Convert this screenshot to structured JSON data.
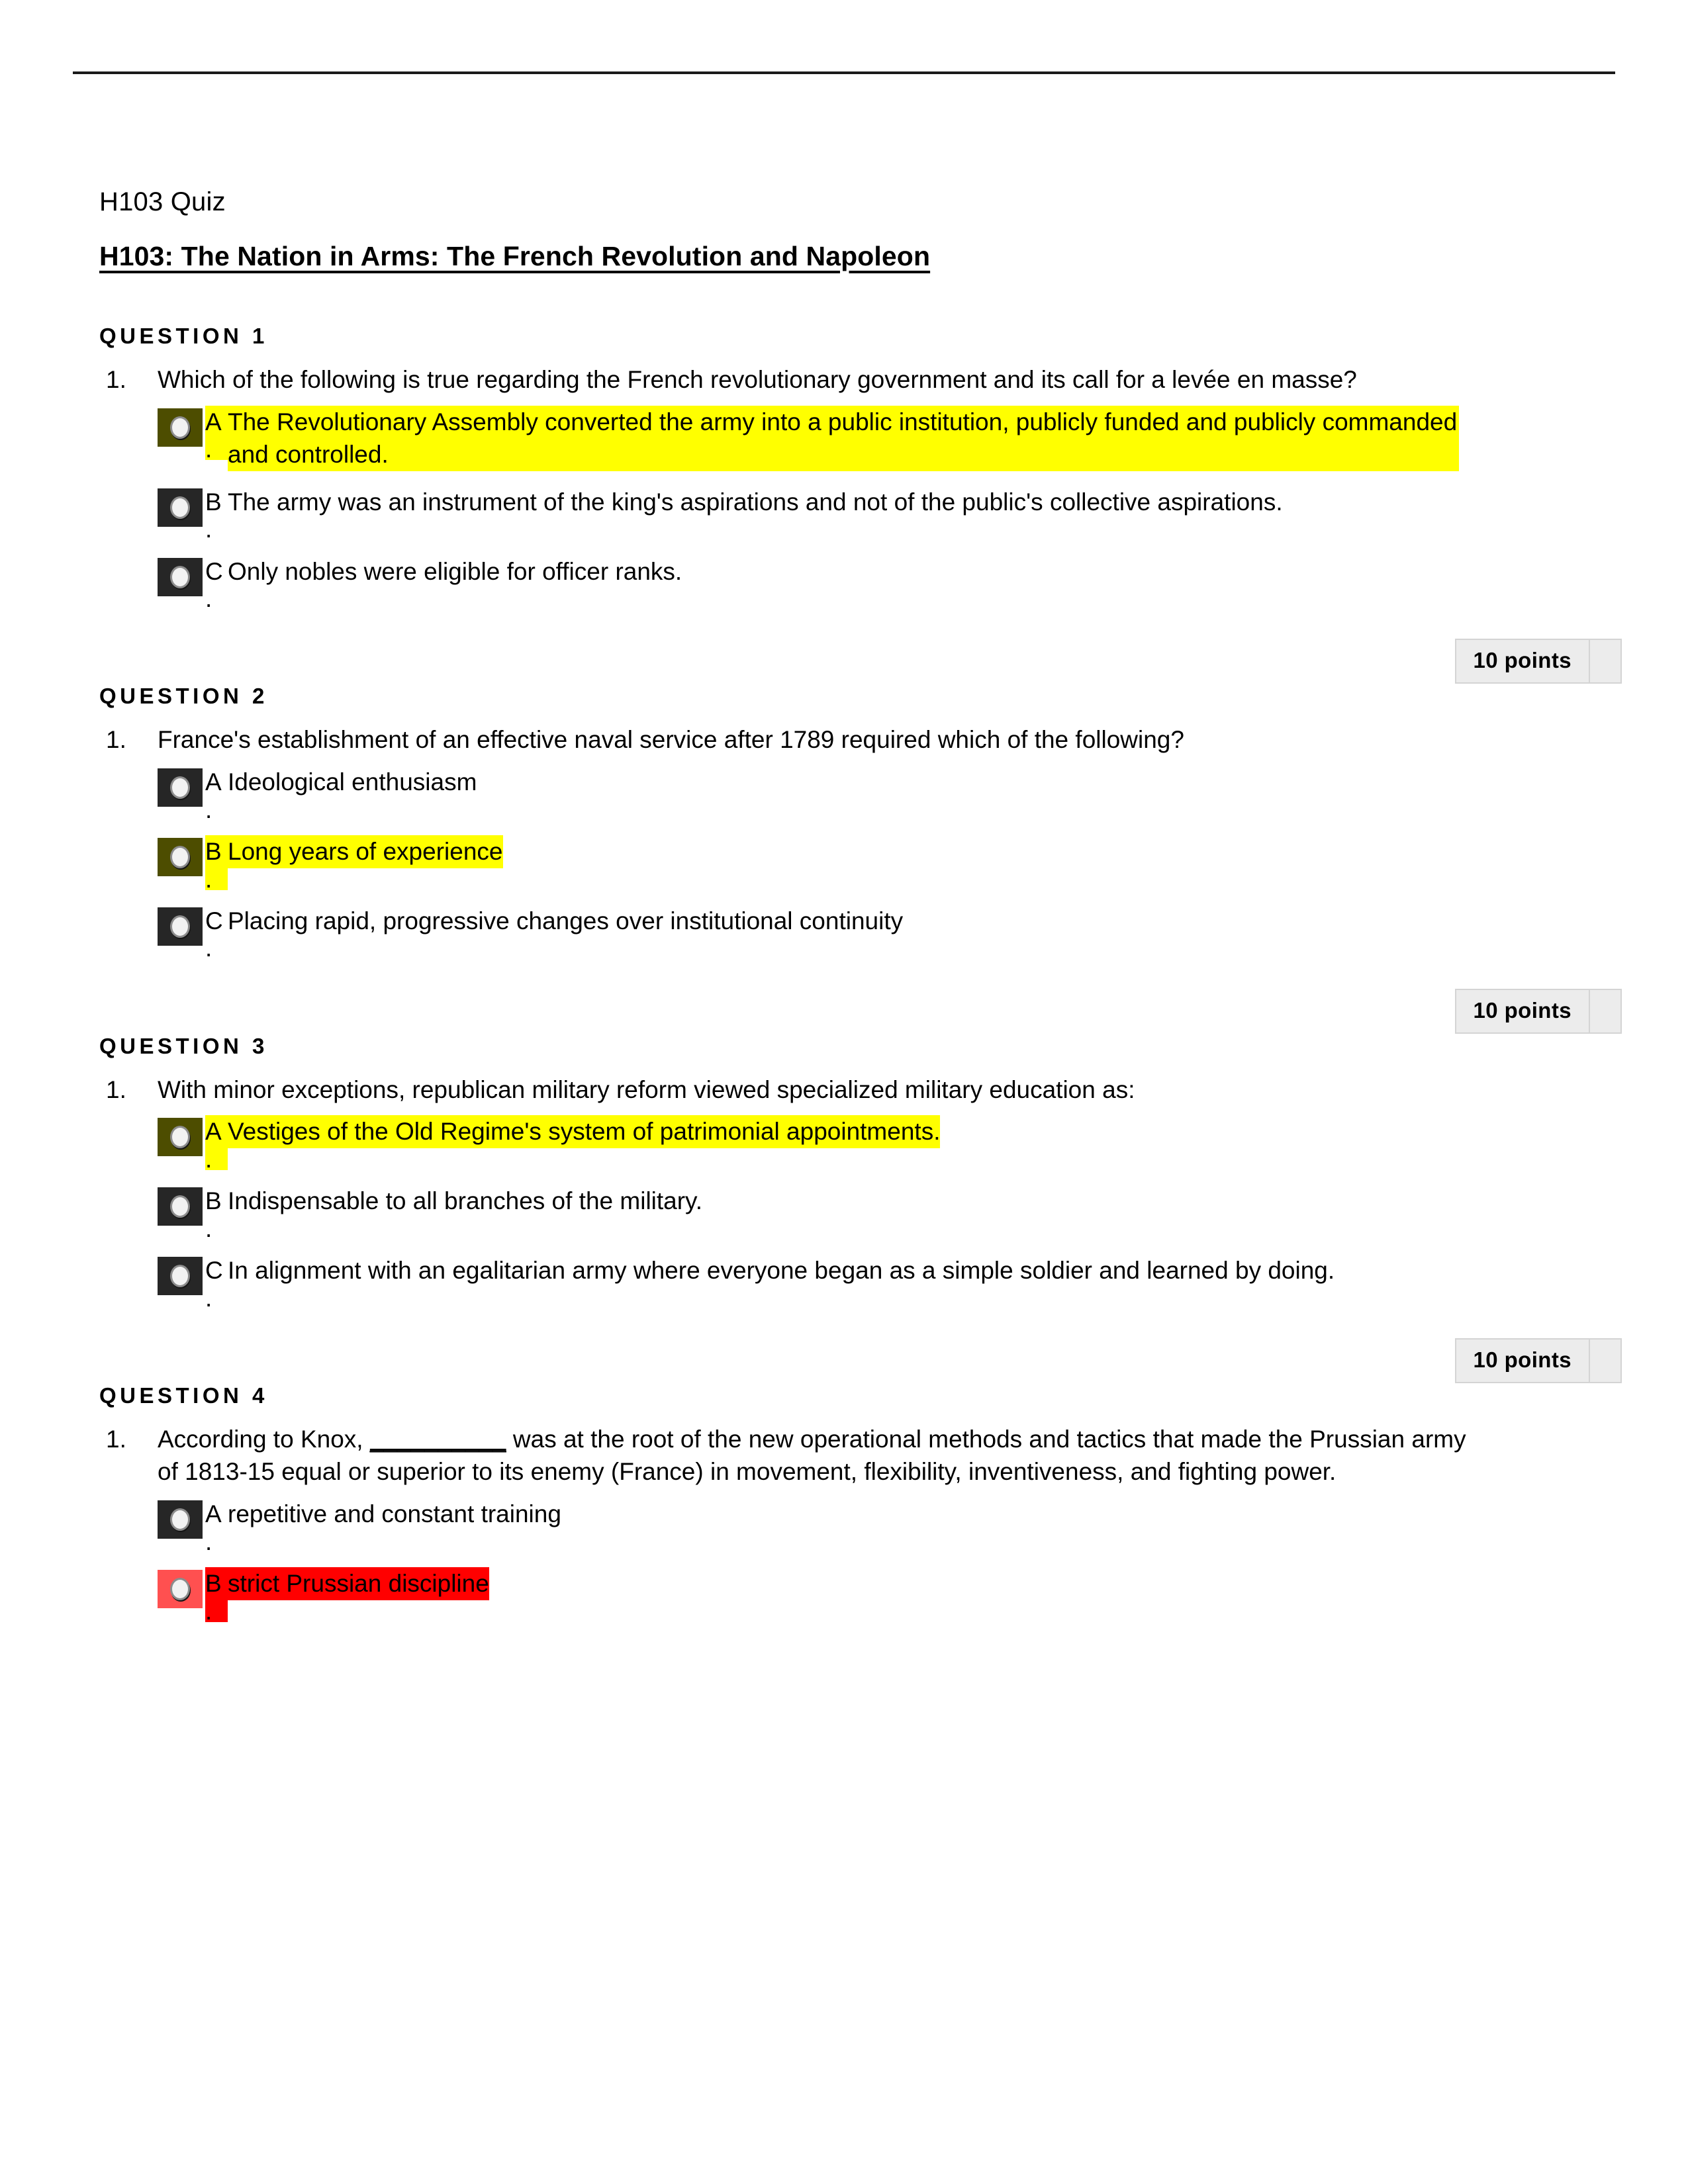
{
  "document": {
    "title": "H103 Quiz",
    "heading": "H103: The Nation in Arms: The French Revolution and Napoleon"
  },
  "colors": {
    "highlight_correct": "#ffff00",
    "highlight_incorrect": "#ff0000",
    "radio_unselected_bg": "#262626",
    "radio_selected_yellow_bg": "#4d4d00",
    "radio_selected_red_bg": "#ff5050",
    "points_bg": "#ececec"
  },
  "questions": [
    {
      "label": "QUESTION 1",
      "number": "1.",
      "prompt": "Which of the following is true regarding the French revolutionary government and its call for a levée en masse?",
      "points": "10 points",
      "options": [
        {
          "letter": "A",
          "dot": ".",
          "text": "The Revolutionary Assembly converted the army into a public institution, publicly funded and publicly commanded and controlled.",
          "highlight": "yellow",
          "selected": true
        },
        {
          "letter": "B",
          "dot": ".",
          "text": "The army was an instrument of the king's aspirations and not of the public's collective aspirations.",
          "highlight": "none",
          "selected": false
        },
        {
          "letter": "C",
          "dot": ".",
          "text": "Only nobles were eligible for officer ranks.",
          "highlight": "none",
          "selected": false
        }
      ]
    },
    {
      "label": "QUESTION 2",
      "number": "1.",
      "prompt": "France's establishment of an effective naval service after 1789 required which of the following?",
      "points": "10 points",
      "options": [
        {
          "letter": "A",
          "dot": ".",
          "text": "Ideological enthusiasm",
          "highlight": "none",
          "selected": false
        },
        {
          "letter": "B",
          "dot": ".",
          "text": "Long years of experience",
          "highlight": "yellow",
          "selected": true
        },
        {
          "letter": "C",
          "dot": ".",
          "text": "Placing rapid, progressive changes over institutional continuity",
          "highlight": "none",
          "selected": false
        }
      ]
    },
    {
      "label": "QUESTION 3",
      "number": "1.",
      "prompt": "With minor exceptions, republican military reform viewed specialized military education as:",
      "points": "10 points",
      "options": [
        {
          "letter": "A",
          "dot": ".",
          "text": "Vestiges of the Old Regime's system of patrimonial appointments.",
          "highlight": "yellow",
          "selected": true
        },
        {
          "letter": "B",
          "dot": ".",
          "text": "Indispensable to all branches of the military.",
          "highlight": "none",
          "selected": false
        },
        {
          "letter": "C",
          "dot": ".",
          "text": "In alignment with an egalitarian army where everyone began as a simple soldier and learned by doing.",
          "highlight": "none",
          "selected": false
        }
      ]
    },
    {
      "label": "QUESTION 4",
      "number": "1.",
      "prompt_part1": "According to Knox, ",
      "prompt_blank": "__________",
      "prompt_part2": " was at the root of the new operational methods and tactics that made the Prussian army of 1813-15 equal or superior to its enemy (France) in movement, flexibility, inventiveness, and fighting power.",
      "points": "",
      "options": [
        {
          "letter": "A",
          "dot": ".",
          "text": "repetitive and constant training",
          "highlight": "none",
          "selected": false
        },
        {
          "letter": "B",
          "dot": ".",
          "text": "strict Prussian discipline",
          "highlight": "red",
          "selected": true
        }
      ]
    }
  ]
}
